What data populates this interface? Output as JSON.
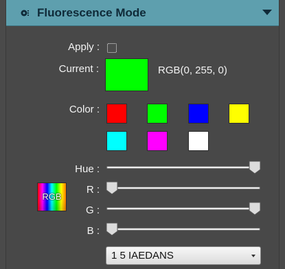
{
  "panel": {
    "title": "Fluorescence Mode",
    "header_icon": "eye-icon",
    "collapse_icon": "triangle-down-icon"
  },
  "apply": {
    "label": "Apply :",
    "checked": false
  },
  "current": {
    "label": "Current :",
    "color": "#00ff00",
    "rgb_text": "RGB(0, 255, 0)"
  },
  "colors": {
    "label": "Color :",
    "swatches": [
      "#ff0000",
      "#00ff00",
      "#0000ff",
      "#ffff00",
      "#00ffff",
      "#ff00ff",
      "#ffffff"
    ]
  },
  "sliders": {
    "hue_label": "Hue :",
    "r_label": "R :",
    "g_label": "G :",
    "b_label": "B :",
    "hue": 1.0,
    "r": 0.0,
    "g": 1.0,
    "b": 0.0
  },
  "rgb_badge": {
    "label": "RGB"
  },
  "preset": {
    "value": "1 5 IAEDANS"
  }
}
